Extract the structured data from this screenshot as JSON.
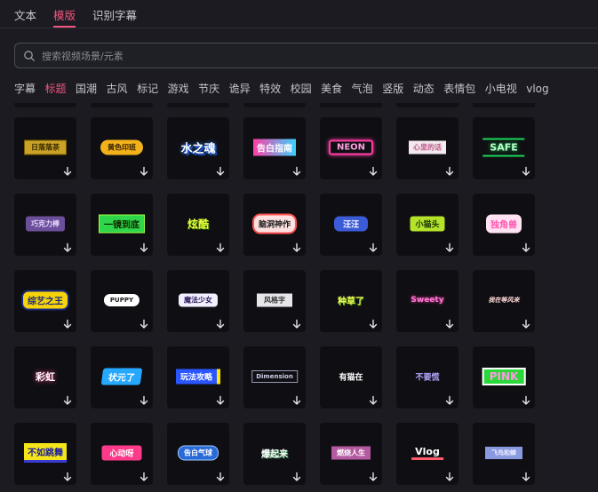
{
  "tabs": [
    "文本",
    "模版",
    "识别字幕"
  ],
  "search": {
    "placeholder": "搜索视频场景/元素"
  },
  "categories": [
    "字幕",
    "标题",
    "国潮",
    "古风",
    "标记",
    "游戏",
    "节庆",
    "诡异",
    "特效",
    "校园",
    "美食",
    "气泡",
    "竖版",
    "动态",
    "表情包",
    "小电视",
    "vlog"
  ],
  "active_category": "标题",
  "templates": [
    [
      "日落落茶",
      "黄色印班",
      "水之魂",
      "告白指南",
      "NEON",
      "心里的话",
      "SAFE"
    ],
    [
      "巧克力棒",
      "一镜到底",
      "炫酷",
      "脑洞神作",
      "汪汪",
      "小猫头",
      "独角兽"
    ],
    [
      "综艺之王",
      "PUPPY",
      "魔法少女",
      "风格字",
      "种草了",
      "Sweety",
      "我在等风来"
    ],
    [
      "彩虹",
      "状元了",
      "玩法攻略",
      "Dimension",
      "有猫在",
      "不要慌",
      "PINK"
    ],
    [
      "不如跳舞",
      "心动呀",
      "告白气球",
      "爆起来",
      "燃烧人生",
      "Vlog",
      "飞鸟和蝉"
    ]
  ],
  "colors": {
    "accent": "#f0557f",
    "bg": "#1b1b21",
    "tile": "#0f0f13"
  }
}
